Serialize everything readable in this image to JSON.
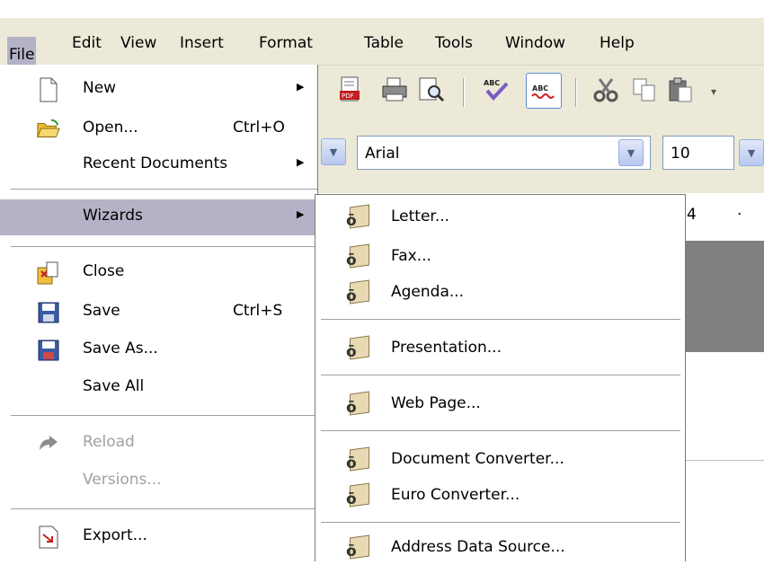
{
  "menubar": {
    "items": [
      "File",
      "Edit",
      "View",
      "Insert",
      "Format",
      "Table",
      "Tools",
      "Window",
      "Help"
    ]
  },
  "toolbar": {
    "font_name": "Arial",
    "font_size": "10",
    "ruler_text": "4"
  },
  "file_menu": {
    "new": "New",
    "open": "Open...",
    "open_shortcut": "Ctrl+O",
    "recent": "Recent Documents",
    "wizards": "Wizards",
    "close": "Close",
    "save": "Save",
    "save_shortcut": "Ctrl+S",
    "save_as": "Save As...",
    "save_all": "Save All",
    "reload": "Reload",
    "versions": "Versions...",
    "export": "Export..."
  },
  "wizards_menu": {
    "letter": "Letter...",
    "fax": "Fax...",
    "agenda": "Agenda...",
    "presentation": "Presentation...",
    "web_page": "Web Page...",
    "doc_converter": "Document Converter...",
    "euro_converter": "Euro Converter...",
    "address_source": "Address Data Source..."
  },
  "colors": {
    "highlight": "#b3b2c6",
    "menubar_bg": "#ece9d8",
    "disabled_text": "#a0a0a0"
  }
}
